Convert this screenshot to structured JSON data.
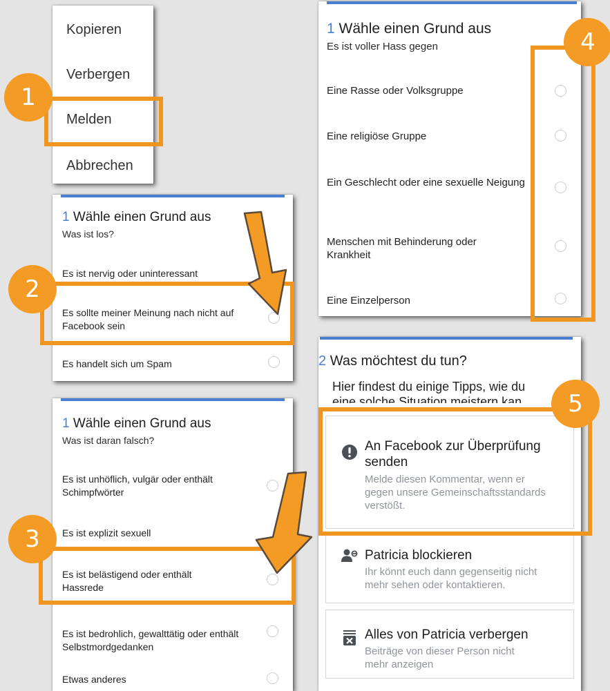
{
  "menu": {
    "items": [
      "Kopieren",
      "Verbergen",
      "Melden",
      "Abbrechen"
    ]
  },
  "steps": {
    "one": "1",
    "two": "2",
    "three": "3",
    "four": "4",
    "five": "5"
  },
  "panel_a": {
    "title_num": "1",
    "title": "Wähle einen Grund aus",
    "subtitle": "Was ist los?",
    "options": [
      "Es ist nervig oder uninteressant",
      "Es sollte meiner Meinung nach nicht auf Facebook sein",
      "Es handelt sich um Spam"
    ]
  },
  "panel_b": {
    "title_num": "1",
    "title": "Wähle einen Grund aus",
    "subtitle": "Was ist daran falsch?",
    "options": [
      "Es ist unhöflich, vulgär oder enthält Schimpfwörter",
      "Es ist explizit sexuell",
      "Es ist belästigend oder enthält Hassrede",
      "Es ist bedrohlich, gewalttätig oder enthält Selbstmordgedanken",
      "Etwas anderes"
    ]
  },
  "panel_c": {
    "title_num": "1",
    "title": "Wähle einen Grund aus",
    "subtitle": "Es ist voller Hass gegen",
    "options": [
      "Eine Rasse oder Volksgruppe",
      "Eine religiöse Gruppe",
      "Ein Geschlecht oder eine sexuelle Neigung",
      "Menschen mit Behinderung oder Krankheit",
      "Eine Einzelperson"
    ]
  },
  "panel_d": {
    "title_num": "2",
    "title": "Was möchtest du tun?",
    "intro_line1": "Hier findest du einige Tipps, wie du",
    "intro_line2": "eine solche Situation meistern kan",
    "actions": [
      {
        "icon": "exclamation-circle-icon",
        "title": "An Facebook zur Überprüfung senden",
        "desc": "Melde diesen Kommentar, wenn er gegen unsere Gemeinschaftsstandards verstößt."
      },
      {
        "icon": "block-user-icon",
        "title": "Patricia blockieren",
        "desc": "Ihr könnt euch dann gegenseitig nicht mehr sehen oder kontaktieren."
      },
      {
        "icon": "hide-all-icon",
        "title": "Alles von Patricia verbergen",
        "desc": "Beiträge von dieser Person nicht mehr anzeigen"
      }
    ]
  },
  "colors": {
    "accent_orange": "#f39b24",
    "facebook_blue": "#4a7ed3",
    "background": "#e4e4e4"
  }
}
